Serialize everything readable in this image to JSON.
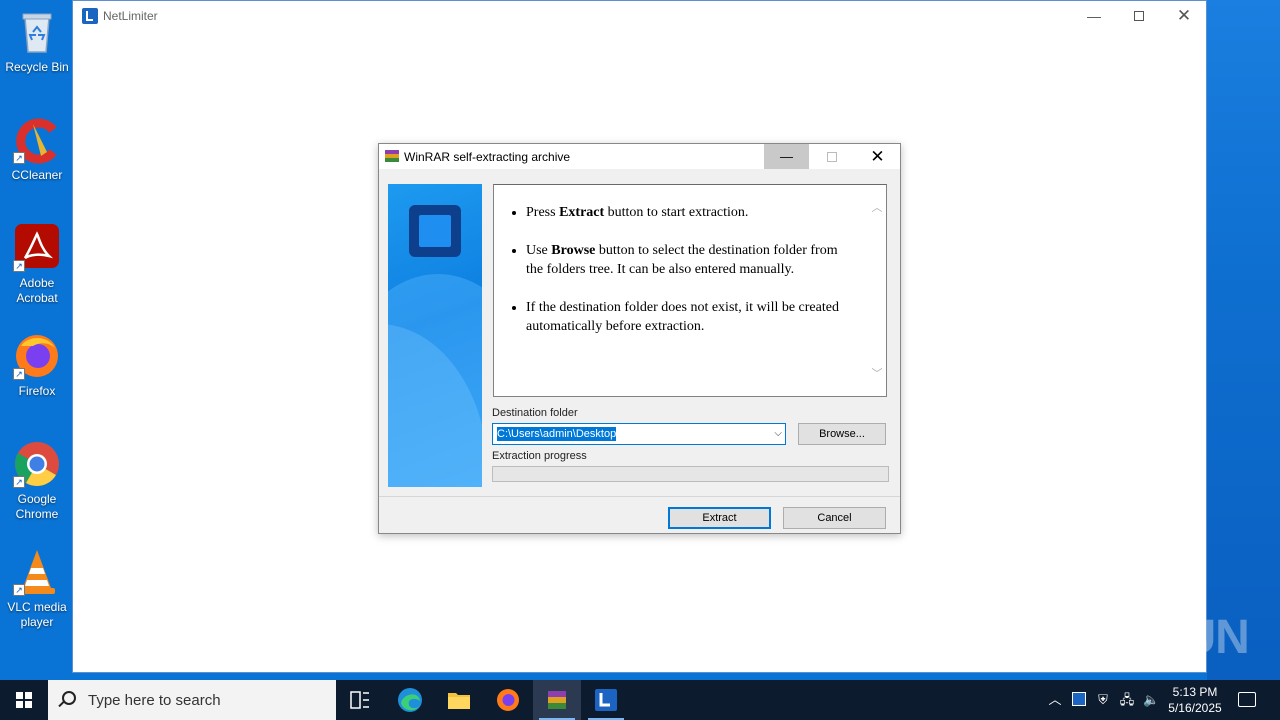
{
  "desktop": {
    "icons": [
      {
        "label": "Recycle Bin"
      },
      {
        "label": "CCleaner"
      },
      {
        "label": "Adobe Acrobat"
      },
      {
        "label": "Firefox"
      },
      {
        "label": "Google Chrome"
      },
      {
        "label": "VLC media player"
      }
    ]
  },
  "netlimiter": {
    "title": "NetLimiter"
  },
  "dialog": {
    "title": "WinRAR self-extracting archive",
    "bullets": [
      {
        "pre": "Press ",
        "bold": "Extract",
        "post": " button to start extraction."
      },
      {
        "pre": "Use ",
        "bold": "Browse",
        "post": " button to select the destination folder from the folders tree. It can be also entered manually."
      },
      {
        "pre": "If the destination folder does not exist, it will be created automatically before extraction.",
        "bold": "",
        "post": ""
      }
    ],
    "destination_label": "Destination folder",
    "destination_value": "C:\\Users\\admin\\Desktop",
    "browse_label": "Browse...",
    "progress_label": "Extraction progress",
    "progress": 0,
    "extract_label": "Extract",
    "cancel_label": "Cancel"
  },
  "watermark": "ANY RUN",
  "taskbar": {
    "search_placeholder": "Type here to search",
    "time": "5:13 PM",
    "date": "5/16/2025"
  }
}
